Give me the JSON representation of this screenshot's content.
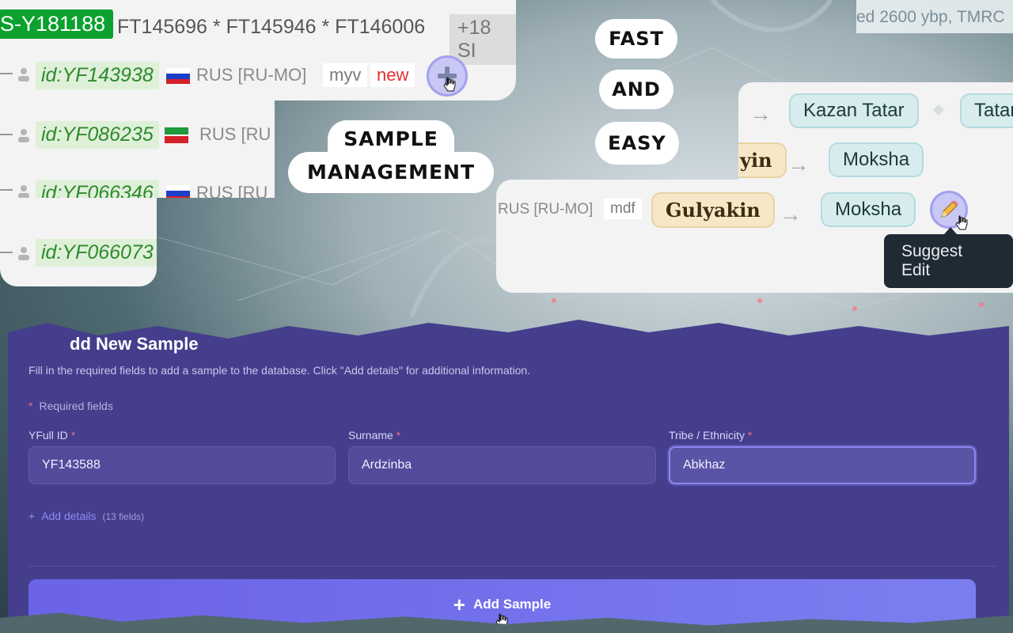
{
  "headlines": {
    "fast": "FAST",
    "and": "AND",
    "easy": "EASY",
    "sample_line1": "SAMPLE",
    "sample_line2": "MANAGEMENT"
  },
  "tree": {
    "haplogroup": "S-Y181188",
    "snps": "FT145696 * FT145946 * FT146006",
    "more": "+18 SI",
    "rows": [
      {
        "id": "id:YF143938",
        "country": "RUS [RU-MO]",
        "lang": "myv",
        "tag": "new",
        "flag": "russia"
      },
      {
        "id": "id:YF086235",
        "country": "RUS [RU",
        "flag": "tatarstan"
      },
      {
        "id": "id:YF066346",
        "country": "RUS [RU",
        "flag": "russia"
      },
      {
        "id": "id:YF066073",
        "flag": "none"
      }
    ],
    "add_button_icon": "plus-icon"
  },
  "tmrca_text": "ed 2600 ybp, TMRC",
  "ethnic": {
    "row1": {
      "to": "Kazan Tatar",
      "extra": "Tatar"
    },
    "row2": {
      "surname_tail": "yin",
      "to": "Moksha"
    },
    "row3": {
      "country": "RUS [RU-MO]",
      "lang": "mdf",
      "surname": "Gulyakin",
      "to": "Moksha"
    },
    "arrow": "→",
    "edit_icon": "pencil-icon",
    "tooltip": "Suggest Edit"
  },
  "form": {
    "title": "Add New Sample",
    "title_visible": "dd New Sample",
    "description": "Fill in the required fields to add a sample to the database. Click \"Add details\" for additional information.",
    "required_note": "Required fields",
    "required_mark": "*",
    "fields": [
      {
        "label": "YFull ID",
        "value": "YF143588"
      },
      {
        "label": "Surname",
        "value": "Ardzinba"
      },
      {
        "label": "Tribe / Ethnicity",
        "value": "Abkhaz"
      }
    ],
    "add_details": "Add details",
    "add_details_count": "(13 fields)",
    "submit": "Add Sample"
  },
  "colors": {
    "accent": "#6b63e6",
    "panel": "#443e8c",
    "required": "#f06b8c",
    "haplogroup": "#0aa12f"
  }
}
